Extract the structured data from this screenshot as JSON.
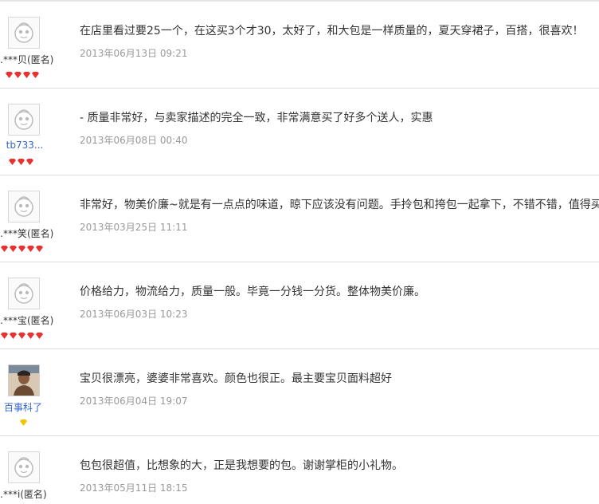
{
  "reviews": [
    {
      "user": "…***贝(匿名)",
      "comment": "在店里看过要25一个，在这买3个才30，太好了，和大包是一样质量的，夏天穿裙子，百搭，很喜欢！",
      "date": "2013年06月13日 09:21",
      "gems": 4
    },
    {
      "user": "tb733...",
      "comment": "- 质量非常好，与卖家描述的完全一致，非常满意买了好多个送人，实惠",
      "date": "2013年06月08日 00:40",
      "gems": 3
    },
    {
      "user": "…***笑(匿名)",
      "comment": "非常好，物美价廉~就是有一点点的味道，晾下应该没有问题。手拎包和挎包一起拿下，不错不错，值得买",
      "date": "2013年03月25日 11:11",
      "gems": 5
    },
    {
      "user": "…***宝(匿名)",
      "comment": "价格给力，物流给力，质量一般。毕竟一分钱一分货。整体物美价廉。",
      "date": "2013年06月03日 10:23",
      "gems": 5
    },
    {
      "user": "百事科了",
      "comment": "宝贝很漂亮，婆婆非常喜欢。颜色也很正。最主要宝贝面料超好",
      "date": "2013年06月04日 19:07",
      "gems": 1
    },
    {
      "user": "…***i(匿名)",
      "comment": "包包很超值，比想象的大，正是我想要的包。谢谢掌柜的小礼物。",
      "date": "2013年05月11日 18:15",
      "gems": 0
    }
  ],
  "colors": {
    "gem_red": "#e8322f",
    "gem_yellow": "#f2c500",
    "link": "#3366cc",
    "date": "#999999"
  }
}
